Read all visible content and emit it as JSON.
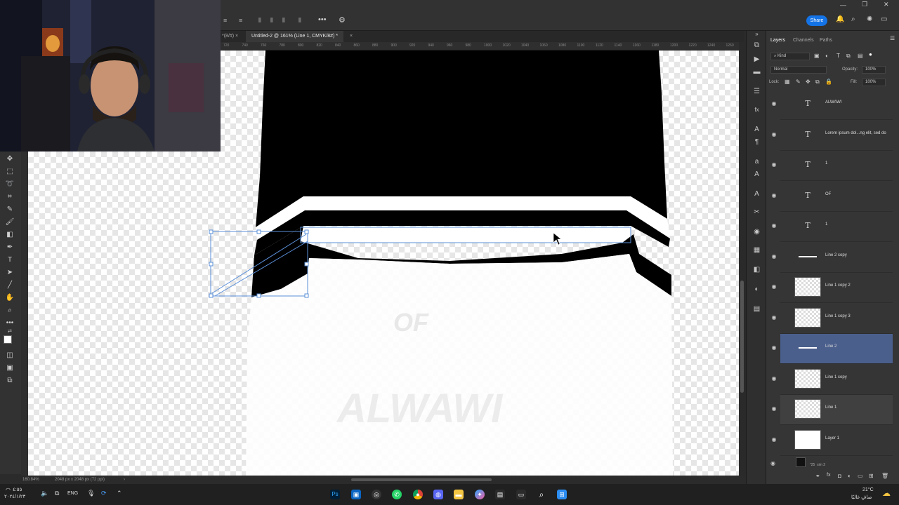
{
  "window": {
    "share_label": "Share"
  },
  "document_tabs": [
    {
      "label": "*(8/#) ×"
    },
    {
      "label": "Untitled-2 @ 161% (Line 1, CMYK/8#) *"
    },
    {
      "label": "×"
    }
  ],
  "ruler_ticks": [
    "720",
    "740",
    "760",
    "780",
    "800",
    "820",
    "840",
    "860",
    "880",
    "900",
    "920",
    "940",
    "960",
    "980",
    "1000",
    "1020",
    "1040",
    "1060",
    "1080",
    "1100",
    "1120",
    "1140",
    "1160",
    "1180",
    "1200",
    "1220",
    "1240",
    "1260"
  ],
  "status": {
    "zoom": "160.84%",
    "doc_info": "2048 px x 2048 px (72 ppi)",
    "arrow": "›"
  },
  "panel": {
    "tabs": [
      "Layers",
      "Channels",
      "Paths"
    ],
    "kind_label": "Kind",
    "blend_mode": "Normal",
    "opacity_label": "Opacity:",
    "opacity_value": "100%",
    "lock_label": "Lock:",
    "fill_label": "Fill:",
    "fill_value": "100%",
    "layers": [
      {
        "name": "ALWAWI",
        "type": "text",
        "state": "normal"
      },
      {
        "name": "Lorem ipsum dol...ng elit, sed do",
        "type": "text",
        "state": "normal"
      },
      {
        "name": "1",
        "type": "text",
        "state": "normal"
      },
      {
        "name": "OF",
        "type": "text",
        "state": "normal"
      },
      {
        "name": "1",
        "type": "text",
        "state": "normal"
      },
      {
        "name": "Line 2 copy",
        "type": "line",
        "state": "normal"
      },
      {
        "name": "Line 1 copy 2",
        "type": "smart",
        "state": "normal"
      },
      {
        "name": "Line 1 copy 3",
        "type": "smart",
        "state": "normal"
      },
      {
        "name": "Line 2",
        "type": "line",
        "state": "selected"
      },
      {
        "name": "Line 1 copy",
        "type": "smart",
        "state": "normal"
      },
      {
        "name": "Line 1",
        "type": "smart",
        "state": "highlight"
      },
      {
        "name": "Layer 1",
        "type": "solid",
        "state": "normal"
      }
    ],
    "partial_layer": "\"25  sim 2"
  },
  "taskbar": {
    "language": "ENG",
    "weather_temp": "21°C",
    "weather_text": "صافٍ غالبًا",
    "clock_time": "٤:٥٥",
    "clock_date": "٢٠٢٤/١/٢٣"
  },
  "colors": {
    "selection_blue": "#4b5f8c",
    "panel_bg": "#353535",
    "canvas_black": "#000000"
  }
}
